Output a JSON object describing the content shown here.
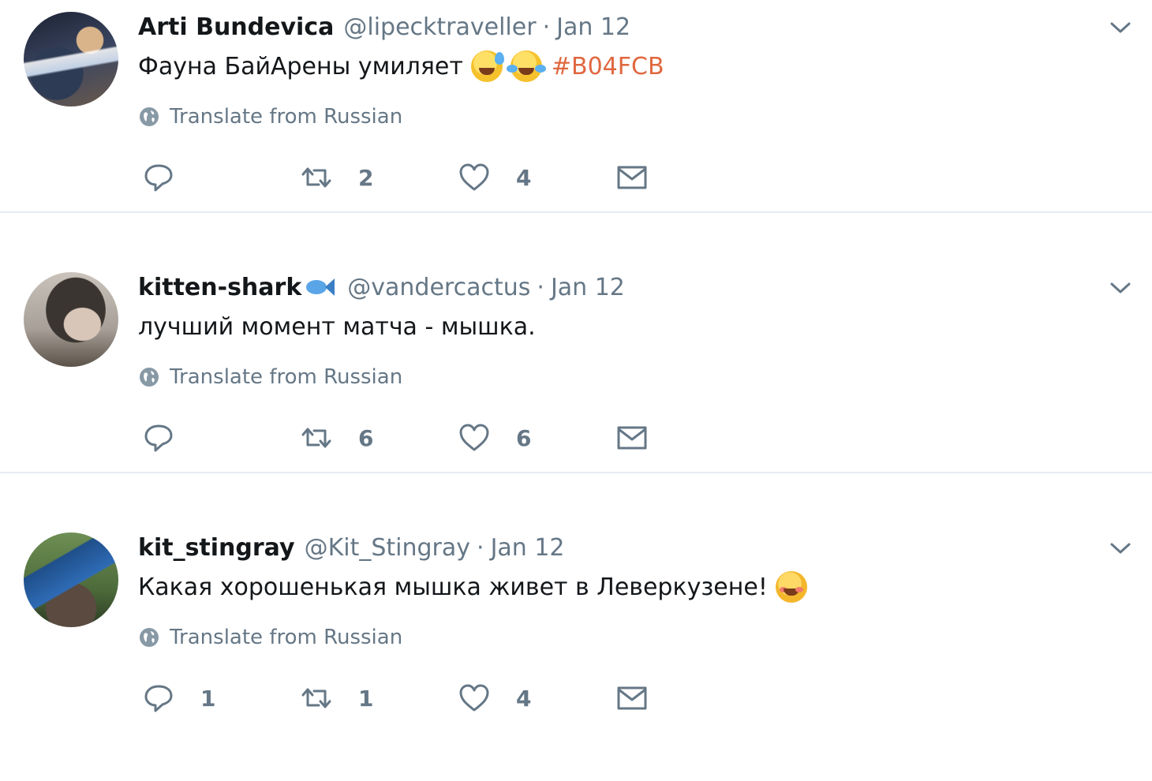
{
  "tweets": [
    {
      "name": "Arti Bundevica",
      "handle": "@lipecktraveller",
      "separator": "·",
      "date": "Jan 12",
      "text": "Фауна БайАрены умиляет",
      "emojis": [
        "grinning-sweat-emoji",
        "tears-of-joy-emoji"
      ],
      "hashtag": "#B04FCB",
      "translate_label": "Translate from Russian",
      "replies": "",
      "retweets": "2",
      "likes": "4"
    },
    {
      "name": "kitten-shark",
      "name_emoji": "fish-emoji",
      "handle": "@vandercactus",
      "separator": "·",
      "date": "Jan 12",
      "text": "лучший момент матча - мышка.",
      "translate_label": "Translate from Russian",
      "replies": "",
      "retweets": "6",
      "likes": "6"
    },
    {
      "name": "kit_stingray",
      "handle": "@Kit_Stingray",
      "separator": "·",
      "date": "Jan 12",
      "text": "Какая хорошенькая мышка живет в Леверкузене!",
      "emojis": [
        "smiling-blush-emoji"
      ],
      "translate_label": "Translate from Russian",
      "replies": "1",
      "retweets": "1",
      "likes": "4"
    }
  ],
  "colors": {
    "text": "#14171a",
    "muted": "#657786",
    "hashtag": "#e0673f",
    "divider": "#e6ecf0"
  }
}
